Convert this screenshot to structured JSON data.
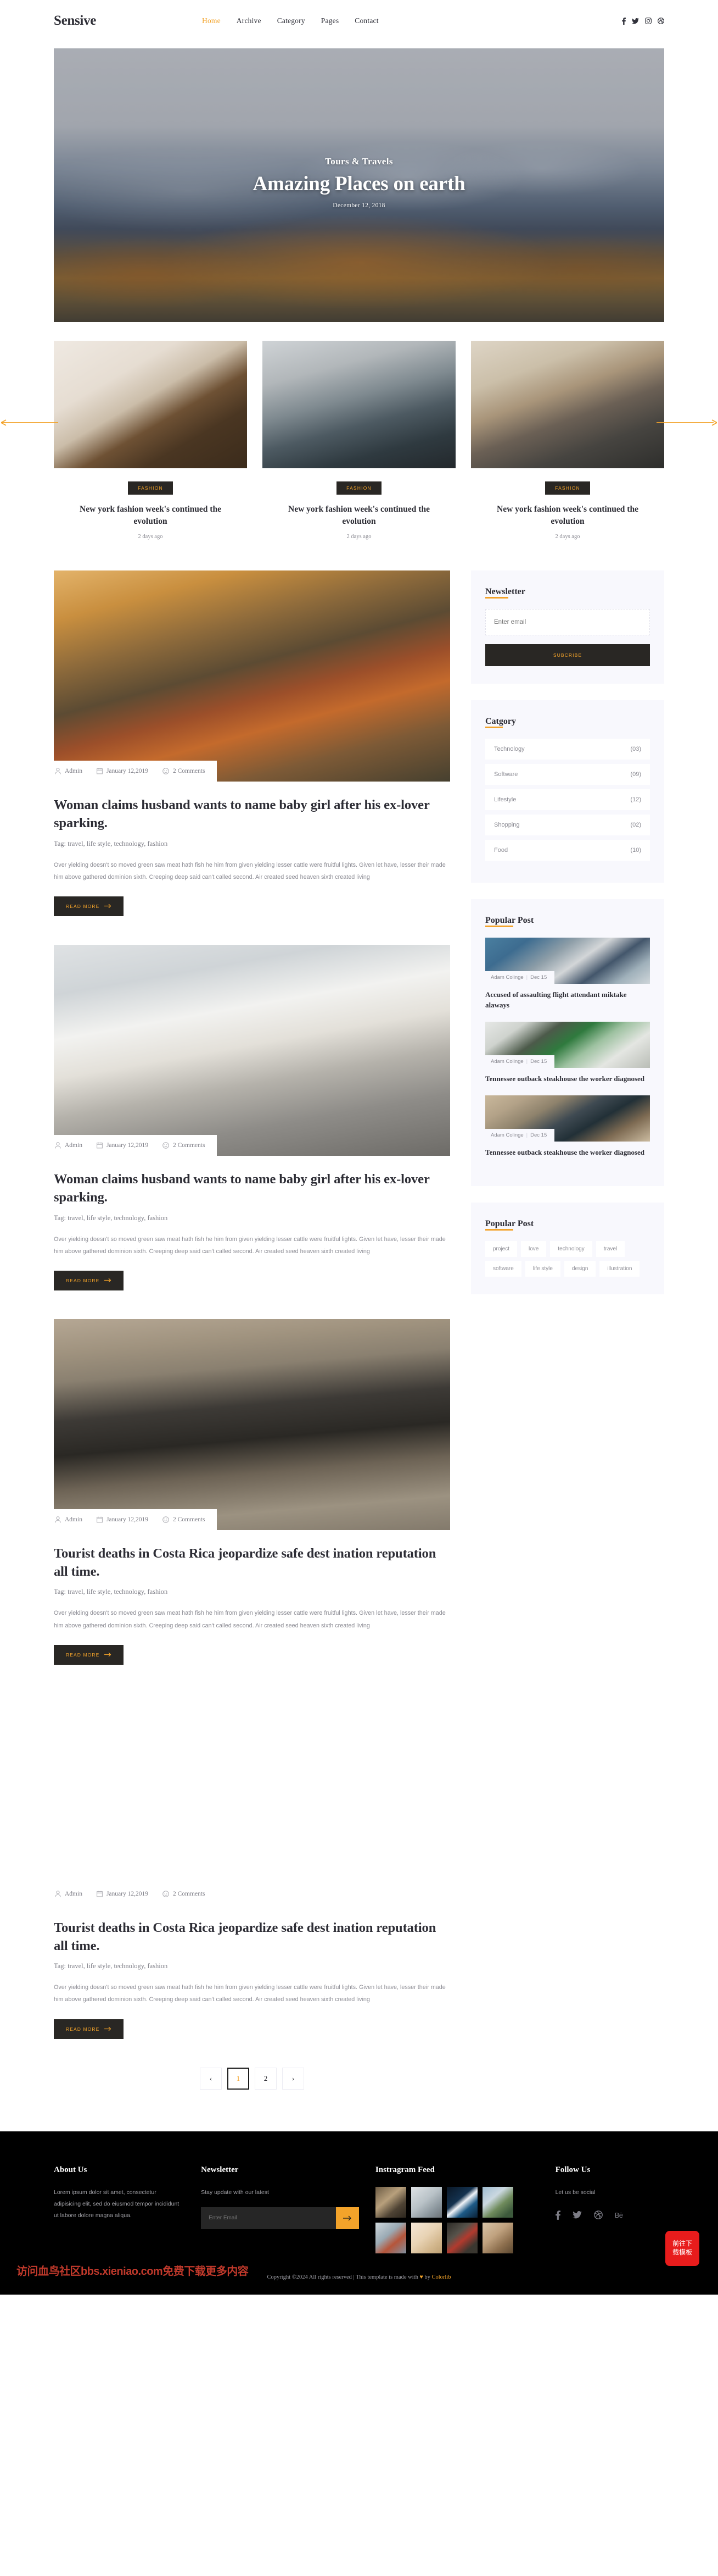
{
  "header": {
    "logo": "Sensive",
    "nav": [
      {
        "label": "Home",
        "active": true
      },
      {
        "label": "Archive",
        "active": false
      },
      {
        "label": "Category",
        "active": false
      },
      {
        "label": "Pages",
        "active": false
      },
      {
        "label": "Contact",
        "active": false
      }
    ],
    "social": [
      "facebook-icon",
      "twitter-icon",
      "instagram-icon",
      "dribbble-icon"
    ]
  },
  "hero": {
    "subtitle": "Tours & Travels",
    "title": "Amazing Places on earth",
    "date": "December 12, 2018"
  },
  "carousel": {
    "prev_label": "previous-slide",
    "next_label": "next-slide",
    "cards": [
      {
        "category": "FASHION",
        "title": "New york fashion week's continued the evolution",
        "ago": "2 days ago"
      },
      {
        "category": "FASHION",
        "title": "New york fashion week's continued the evolution",
        "ago": "2 days ago"
      },
      {
        "category": "FASHION",
        "title": "New york fashion week's continued the evolution",
        "ago": "2 days ago"
      }
    ]
  },
  "posts": [
    {
      "author": "Admin",
      "date": "January 12,2019",
      "comments": "2 Comments",
      "title": "Woman claims husband wants to name baby girl after his ex-lover sparking.",
      "tags": "Tag: travel, life style, technology, fashion",
      "excerpt": "Over yielding doesn't so moved green saw meat hath fish he him from given yielding lesser cattle were fruitful lights. Given let have, lesser their made him above gathered dominion sixth. Creeping deep said can't called second. Air created seed heaven sixth created living",
      "read_more": "READ MORE"
    },
    {
      "author": "Admin",
      "date": "January 12,2019",
      "comments": "2 Comments",
      "title": "Woman claims husband wants to name baby girl after his ex-lover sparking.",
      "tags": "Tag: travel, life style, technology, fashion",
      "excerpt": "Over yielding doesn't so moved green saw meat hath fish he him from given yielding lesser cattle were fruitful lights. Given let have, lesser their made him above gathered dominion sixth. Creeping deep said can't called second. Air created seed heaven sixth created living",
      "read_more": "READ MORE"
    },
    {
      "author": "Admin",
      "date": "January 12,2019",
      "comments": "2 Comments",
      "title": "Tourist deaths in Costa Rica jeopardize safe dest ination reputation all time.",
      "tags": "Tag: travel, life style, technology, fashion",
      "excerpt": "Over yielding doesn't so moved green saw meat hath fish he him from given yielding lesser cattle were fruitful lights. Given let have, lesser their made him above gathered dominion sixth. Creeping deep said can't called second. Air created seed heaven sixth created living",
      "read_more": "READ MORE"
    },
    {
      "author": "Admin",
      "date": "January 12,2019",
      "comments": "2 Comments",
      "title": "Tourist deaths in Costa Rica jeopardize safe dest ination reputation all time.",
      "tags": "Tag: travel, life style, technology, fashion",
      "excerpt": "Over yielding doesn't so moved green saw meat hath fish he him from given yielding lesser cattle were fruitful lights. Given let have, lesser their made him above gathered dominion sixth. Creeping deep said can't called second. Air created seed heaven sixth created living",
      "read_more": "READ MORE"
    }
  ],
  "sidebar": {
    "newsletter": {
      "title": "Newsletter",
      "placeholder": "Enter email",
      "value": "",
      "button": "SUBCRIBE"
    },
    "category": {
      "title": "Catgory",
      "items": [
        {
          "label": "Technology",
          "count": "(03)"
        },
        {
          "label": "Software",
          "count": "(09)"
        },
        {
          "label": "Lifestyle",
          "count": "(12)"
        },
        {
          "label": "Shopping",
          "count": "(02)"
        },
        {
          "label": "Food",
          "count": "(10)"
        }
      ]
    },
    "popular": {
      "title": "Popular Post",
      "items": [
        {
          "author": "Adam Colinge",
          "date": "Dec 15",
          "title": "Accused of assaulting flight attendant miktake alaways"
        },
        {
          "author": "Adam Colinge",
          "date": "Dec 15",
          "title": "Tennessee outback steakhouse the worker diagnosed"
        },
        {
          "author": "Adam Colinge",
          "date": "Dec 15",
          "title": "Tennessee outback steakhouse the worker diagnosed"
        }
      ]
    },
    "tags": {
      "title": "Popular Post",
      "items": [
        "project",
        "love",
        "technology",
        "travel",
        "software",
        "life style",
        "design",
        "illustration"
      ]
    }
  },
  "pagination": {
    "prev": "‹",
    "pages": [
      {
        "label": "1",
        "current": true
      },
      {
        "label": "2",
        "current": false
      }
    ],
    "next": "›"
  },
  "footer": {
    "about": {
      "title": "About Us",
      "text": "Lorem ipsum dolor sit amet, consectetur adipisicing elit, sed do eiusmod tempor incididunt ut labore dolore magna aliqua."
    },
    "newsletter": {
      "title": "Newsletter",
      "text": "Stay update with our latest",
      "placeholder": "Enter Email",
      "value": "",
      "submit_icon": "arrow-right-icon"
    },
    "instagram": {
      "title": "Instragram Feed"
    },
    "follow": {
      "title": "Follow Us",
      "text": "Let us be social",
      "icons": [
        "facebook-icon",
        "twitter-icon",
        "dribbble-icon",
        "behance-icon"
      ]
    },
    "copyright_pre": "Copyright ©2024 All rights reserved | This template is made with ",
    "copyright_heart": "♥",
    "copyright_mid": " by ",
    "copyright_brand": "Colorlib"
  },
  "overlay": {
    "watermark": "访问血鸟社区bbs.xieniao.com免费下载更多内容",
    "download_button": "前往下载模板"
  },
  "colors": {
    "accent": "#f3a32a",
    "dark": "#292724",
    "text": "#2d2d35",
    "muted": "#8b8b93",
    "panel": "#f8f8fd"
  }
}
